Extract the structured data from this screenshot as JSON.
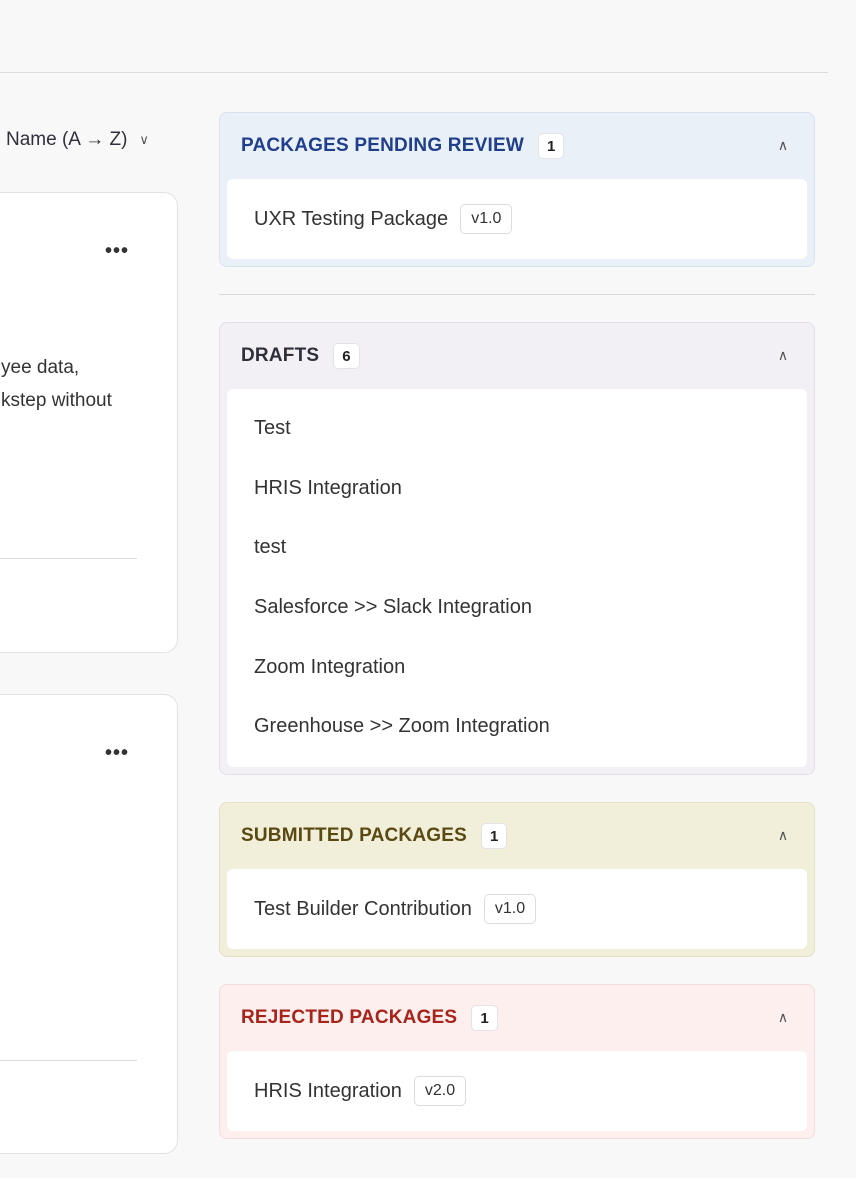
{
  "sort": {
    "label": "Name (A → Z)"
  },
  "cards": [
    {
      "desc_line1": "yee data,",
      "desc_line2": "kstep without",
      "more": "•••"
    },
    {
      "more": "•••"
    }
  ],
  "panels": {
    "pending": {
      "title": "PACKAGES PENDING REVIEW",
      "count": "1",
      "items": [
        {
          "name": "UXR Testing Package",
          "version": "v1.0"
        }
      ]
    },
    "drafts": {
      "title": "DRAFTS",
      "count": "6",
      "items": [
        {
          "name": "Test"
        },
        {
          "name": "HRIS Integration"
        },
        {
          "name": "test"
        },
        {
          "name": "Salesforce >> Slack Integration"
        },
        {
          "name": "Zoom Integration"
        },
        {
          "name": "Greenhouse >> Zoom Integration"
        }
      ]
    },
    "submitted": {
      "title": "SUBMITTED PACKAGES",
      "count": "1",
      "items": [
        {
          "name": "Test Builder Contribution",
          "version": "v1.0"
        }
      ]
    },
    "rejected": {
      "title": "REJECTED PACKAGES",
      "count": "1",
      "items": [
        {
          "name": "HRIS Integration",
          "version": "v2.0"
        }
      ]
    }
  },
  "colors": {
    "pending_bg": "#e9f0f8",
    "pending_border": "#d6e2f0",
    "pending_title": "#1f3f8c",
    "drafts_bg": "#f2f0f5",
    "drafts_border": "#e2dfe8",
    "drafts_title": "#2f2f3a",
    "submitted_bg": "#f1eed9",
    "submitted_border": "#e4e0c4",
    "submitted_title": "#5a4a12",
    "rejected_bg": "#fcefee",
    "rejected_border": "#f1dcda",
    "rejected_title": "#a8231a"
  }
}
